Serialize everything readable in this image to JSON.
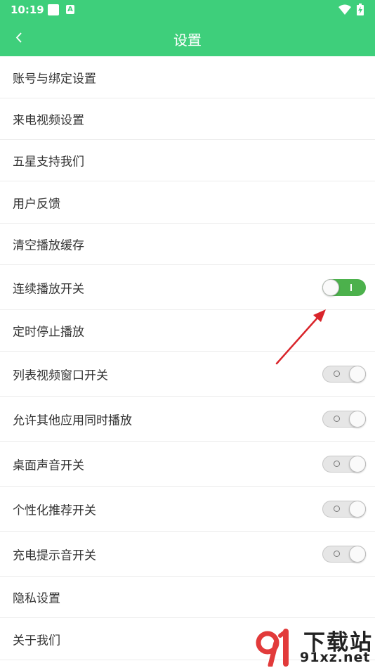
{
  "statusbar": {
    "time": "10:19",
    "a_badge": "A"
  },
  "appbar": {
    "title": "设置",
    "back_icon": "chevron-left-icon"
  },
  "colors": {
    "brand_green": "#3ecf7b",
    "switch_on": "#4cb14c",
    "arrow_red": "#d9242a"
  },
  "settings": {
    "items": [
      {
        "label": "账号与绑定设置"
      },
      {
        "label": "来电视频设置"
      },
      {
        "label": "五星支持我们"
      },
      {
        "label": "用户反馈"
      },
      {
        "label": "清空播放缓存"
      },
      {
        "label": "连续播放开关",
        "switch_on": true
      },
      {
        "label": "定时停止播放"
      },
      {
        "label": "列表视频窗口开关",
        "switch_on": false
      },
      {
        "label": "允许其他应用同时播放",
        "switch_on": false
      },
      {
        "label": "桌面声音开关",
        "switch_on": false
      },
      {
        "label": "个性化推荐开关",
        "switch_on": false
      },
      {
        "label": "充电提示音开关",
        "switch_on": false
      },
      {
        "label": "隐私设置"
      },
      {
        "label": "关于我们"
      }
    ]
  },
  "watermark": {
    "text": "下载站",
    "url": "91xz.net"
  }
}
